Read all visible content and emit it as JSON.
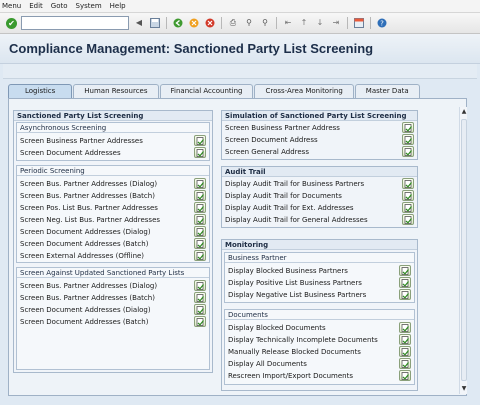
{
  "menu": [
    "Menu",
    "Edit",
    "Goto",
    "System",
    "Help"
  ],
  "title": "Compliance Management: Sanctioned Party List Screening",
  "tabs": [
    "Logistics",
    "Human Resources",
    "Financial Accounting",
    "Cross-Area Monitoring",
    "Master Data"
  ],
  "active_tab": "Logistics",
  "spl": {
    "title": "Sanctioned Party List Screening",
    "async": {
      "title": "Asynchronous Screening",
      "items": [
        "Screen Business Partner Addresses",
        "Screen Document Addresses"
      ]
    },
    "periodic": {
      "title": "Periodic Screening",
      "items": [
        "Screen Bus. Partner Addresses (Dialog)",
        "Screen Bus. Partner Addresses (Batch)",
        "Screen Pos. List Bus. Partner Addresses",
        "Screen Neg. List Bus. Partner Addresses",
        "Screen Document Addresses (Dialog)",
        "Screen Document Addresses (Batch)",
        "Screen External Addresses (Offline)"
      ]
    },
    "updated": {
      "title": "Screen Against Updated Sanctioned Party Lists",
      "items": [
        "Screen Bus. Partner Addresses (Dialog)",
        "Screen Bus. Partner Addresses (Batch)",
        "Screen Document Addresses (Dialog)",
        "Screen Document Addresses (Batch)"
      ]
    }
  },
  "simulation": {
    "title": "Simulation of Sanctioned Party List Screening",
    "items": [
      "Screen Business Partner Address",
      "Screen Document Address",
      "Screen General Address"
    ]
  },
  "audit": {
    "title": "Audit Trail",
    "items": [
      "Display Audit Trail for Business Partners",
      "Display Audit Trail for Documents",
      "Display Audit Trail for Ext. Addresses",
      "Display Audit Trail for General Addresses"
    ]
  },
  "monitoring": {
    "title": "Monitoring",
    "bp": {
      "title": "Business Partner",
      "items": [
        "Display Blocked Business Partners",
        "Display Positive List Business Partners",
        "Display Negative List Business Partners"
      ]
    },
    "docs": {
      "title": "Documents",
      "items": [
        "Display Blocked Documents",
        "Display Technically Incomplete Documents",
        "Manually Release Blocked Documents",
        "Display All Documents",
        "Rescreen Import/Export Documents"
      ]
    }
  },
  "icons": {
    "row_button": "execute-icon",
    "check": "check-icon"
  },
  "colors": {
    "title_text": "#1d2f4a",
    "tab_active": "#c8dcef",
    "button_green": "#4a8a2c"
  }
}
